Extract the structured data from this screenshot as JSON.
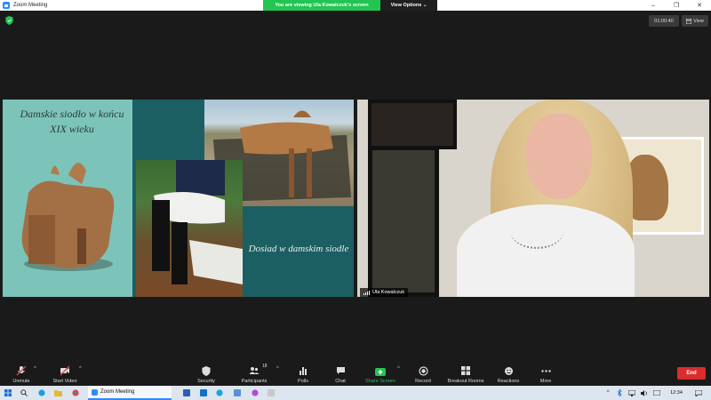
{
  "window": {
    "title": "Zoom Meeting",
    "controls": [
      "–",
      "❐",
      "✕"
    ]
  },
  "banner": {
    "viewing_text": "You are viewing Ula Kowalczuk's screen",
    "view_options": "View Options ⌄"
  },
  "meeting": {
    "timer": "01:00:40",
    "view_label": "View",
    "participant_name": "Ula Kowalczuk"
  },
  "slide": {
    "title_top": "Damskie siodło w końcu XIX wieku",
    "title_bottom": "Dosiad w damskim siodle"
  },
  "toolbar": {
    "unmute": "Unmute",
    "start_video": "Start Video",
    "security": "Security",
    "participants": "Participants",
    "participants_count": "18",
    "polls": "Polls",
    "chat": "Chat",
    "share_screen": "Share Screen",
    "record": "Record",
    "breakout_rooms": "Breakout Rooms",
    "reactions": "Reactions",
    "more": "More",
    "end": "End"
  },
  "taskbar": {
    "zoom_label": "Zoom Meeting",
    "clock": "12:34"
  },
  "colors": {
    "share_green": "#23c552",
    "zoom_blue": "#2d8cff",
    "end_red": "#d92d2d",
    "slide_teal": "#1c5f63",
    "slide_mint": "#7cc4b9"
  }
}
